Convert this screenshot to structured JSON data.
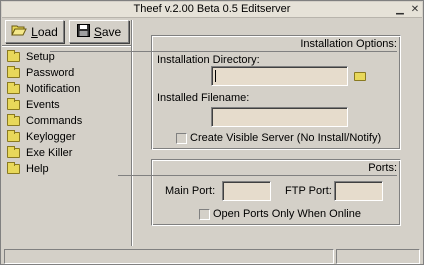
{
  "window": {
    "title": "Theef v.2.00 Beta 0.5 Editserver"
  },
  "titlebar_buttons": {
    "minimize_glyph": "▁",
    "close_glyph": "✕"
  },
  "toolbar": {
    "load_prefix": "",
    "load_accel": "L",
    "load_rest": "oad",
    "save_prefix": "",
    "save_accel": "S",
    "save_rest": "ave"
  },
  "sidebar": {
    "items": [
      {
        "label": "Setup"
      },
      {
        "label": "Password"
      },
      {
        "label": "Notification"
      },
      {
        "label": "Events"
      },
      {
        "label": "Commands"
      },
      {
        "label": "Keylogger"
      },
      {
        "label": "Exe Killer"
      },
      {
        "label": "Help"
      }
    ]
  },
  "install_options": {
    "title": "Installation Options:",
    "dir_label": "Installation Directory:",
    "dir_value": "",
    "filename_label": "Installed Filename:",
    "filename_value": "",
    "visible_label": "Create Visible Server (No Install/Notify)",
    "visible_checked": false
  },
  "ports": {
    "title": "Ports:",
    "main_label": "Main Port:",
    "main_value": "",
    "ftp_label": "FTP Port:",
    "ftp_value": "",
    "online_label": "Open Ports Only When Online",
    "online_checked": false
  },
  "statusbar": {
    "left": "",
    "right": ""
  },
  "colors": {
    "face": "#d4d0c8",
    "field": "#e6dccc",
    "folder": "#e8d85a"
  },
  "icons": {
    "load": "folder-open-icon",
    "save": "floppy-disk-icon",
    "nav": "folder-icon"
  }
}
